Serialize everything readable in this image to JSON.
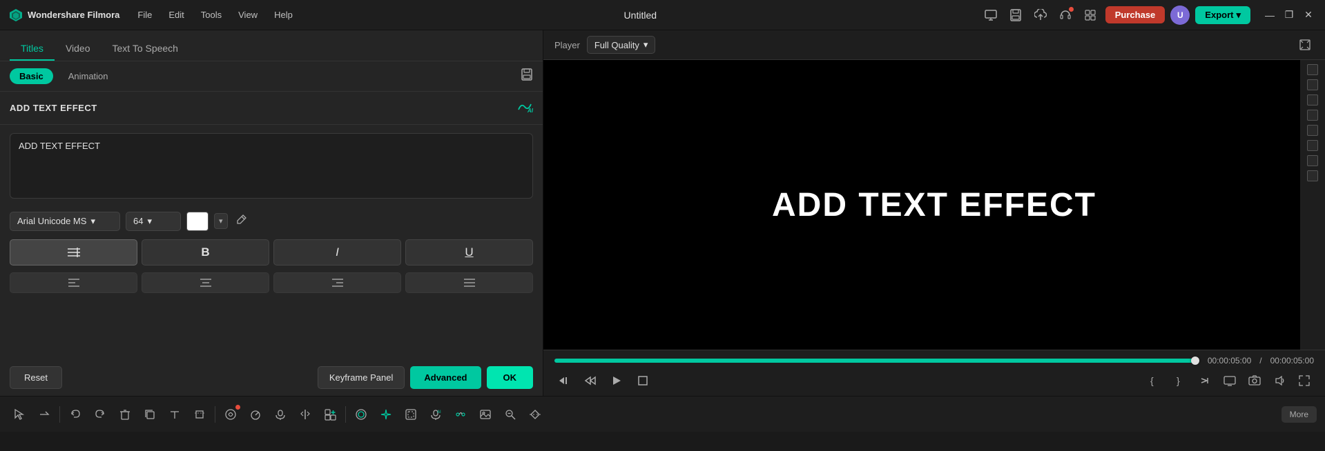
{
  "app": {
    "name": "Wondershare Filmora",
    "logo_text": "Wondershare Filmora"
  },
  "titlebar": {
    "menus": [
      "File",
      "Edit",
      "Tools",
      "View",
      "Help"
    ],
    "title": "Untitled",
    "purchase_label": "Purchase",
    "export_label": "Export",
    "icons": {
      "screen": "🖥",
      "save": "💾",
      "cloud": "☁",
      "headset": "🎧",
      "grid": "⊞"
    },
    "window_controls": [
      "—",
      "❐",
      "✕"
    ]
  },
  "left_panel": {
    "tabs": [
      "Titles",
      "Video",
      "Text To Speech"
    ],
    "active_tab": "Titles",
    "sub_tabs": [
      "Basic",
      "Animation"
    ],
    "active_sub_tab": "Basic",
    "effect_header": "ADD TEXT EFFECT",
    "text_value": "ADD TEXT EFFECT",
    "font_family": "Arial Unicode MS",
    "font_size": "64",
    "color": "#ffffff",
    "style_buttons": [
      {
        "label": "|||",
        "name": "font-style-adjust",
        "active": true
      },
      {
        "label": "B",
        "name": "bold-button",
        "active": false
      },
      {
        "label": "I",
        "name": "italic-button",
        "active": false
      },
      {
        "label": "U",
        "name": "underline-button",
        "active": false
      }
    ],
    "align_buttons": [
      {
        "label": "≡",
        "name": "align-left-button"
      },
      {
        "label": "≡",
        "name": "align-center-button"
      },
      {
        "label": "≡",
        "name": "align-right-button"
      },
      {
        "label": "≡",
        "name": "align-justify-button"
      }
    ],
    "reset_label": "Reset",
    "keyframe_label": "Keyframe Panel",
    "advanced_label": "Advanced",
    "ok_label": "OK"
  },
  "right_panel": {
    "player_label": "Player",
    "quality_label": "Full Quality",
    "video_text": "ADD TEXT EFFECT",
    "current_time": "00:00:05:00",
    "total_time": "00:00:05:00",
    "progress_pct": 100
  },
  "bottom_toolbar": {
    "more_label": "More"
  }
}
